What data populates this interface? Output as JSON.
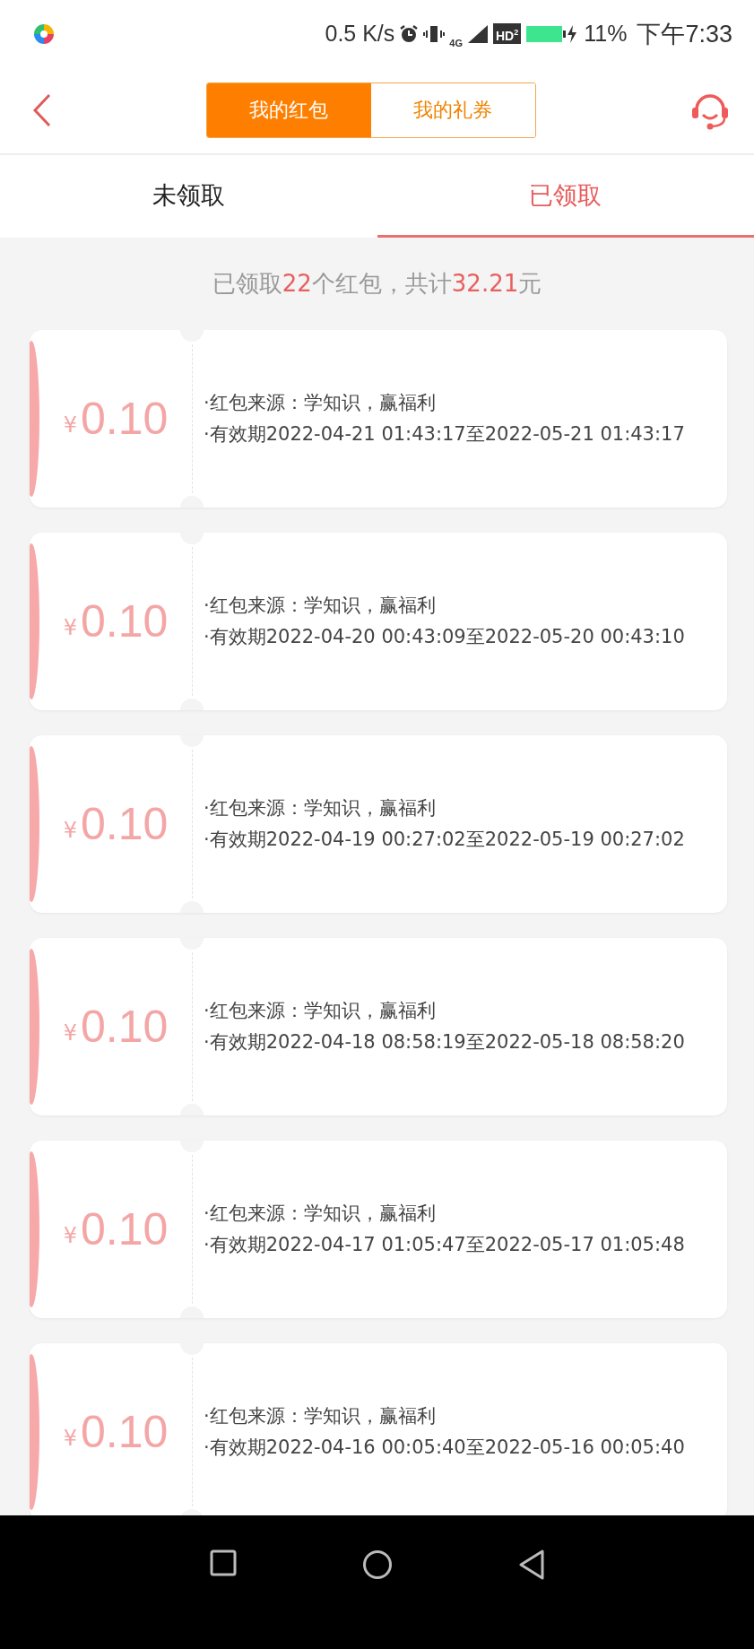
{
  "status_bar": {
    "speed": "0.5 K/s",
    "network": "4G",
    "hd": "HD$^{2}$",
    "battery": "11%",
    "time": "下午7:33"
  },
  "header": {
    "segments": [
      {
        "label": "我的红包",
        "selected": true
      },
      {
        "label": "我的礼券",
        "selected": false
      }
    ]
  },
  "tabs": [
    {
      "label": "未领取",
      "selected": false
    },
    {
      "label": "已领取",
      "selected": true
    }
  ],
  "summary": [
    {
      "text": "已领取",
      "highlight": false
    },
    {
      "text": "22",
      "highlight": true
    },
    {
      "text": "个红包，共计",
      "highlight": false
    },
    {
      "text": "32.21",
      "highlight": true
    },
    {
      "text": "元",
      "highlight": false
    }
  ],
  "coupons": [
    {
      "currency": "¥",
      "amount": "0.10",
      "source": "·红包来源：学知识，赢福利",
      "validity": "·有效期2022-04-21 01:43:17至2022-05-21 01:43:17"
    },
    {
      "currency": "¥",
      "amount": "0.10",
      "source": "·红包来源：学知识，赢福利",
      "validity": "·有效期2022-04-20 00:43:09至2022-05-20 00:43:10"
    },
    {
      "currency": "¥",
      "amount": "0.10",
      "source": "·红包来源：学知识，赢福利",
      "validity": "·有效期2022-04-19 00:27:02至2022-05-19 00:27:02"
    },
    {
      "currency": "¥",
      "amount": "0.10",
      "source": "·红包来源：学知识，赢福利",
      "validity": "·有效期2022-04-18 08:58:19至2022-05-18 08:58:20"
    },
    {
      "currency": "¥",
      "amount": "0.10",
      "source": "·红包来源：学知识，赢福利",
      "validity": "·有效期2022-04-17 01:05:47至2022-05-17 01:05:48"
    },
    {
      "currency": "¥",
      "amount": "0.10",
      "source": "·红包来源：学知识，赢福利",
      "validity": "·有效期2022-04-16 00:05:40至2022-05-16 00:05:40"
    }
  ]
}
